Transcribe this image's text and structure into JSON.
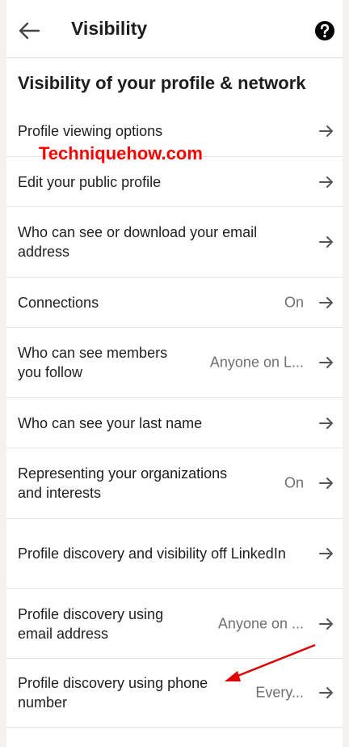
{
  "header": {
    "title": "Visibility",
    "back_icon": "arrow-left-icon",
    "help_icon": "help-circle-icon"
  },
  "section_title": "Visibility of your profile & network",
  "watermark": "Techniquehow.com",
  "rows": [
    {
      "label": "Profile viewing options",
      "value": ""
    },
    {
      "label": "Edit your public profile",
      "value": ""
    },
    {
      "label": "Who can see or download your email address",
      "value": ""
    },
    {
      "label": "Connections",
      "value": "On"
    },
    {
      "label": "Who can see members you follow",
      "value": "Anyone on L..."
    },
    {
      "label": "Who can see your last name",
      "value": ""
    },
    {
      "label": "Representing your organizations and interests",
      "value": "On"
    },
    {
      "label": "Profile discovery and visibility off LinkedIn",
      "value": ""
    },
    {
      "label": "Profile discovery using email address",
      "value": "Anyone on ..."
    },
    {
      "label": "Profile discovery using phone number",
      "value": "Every..."
    }
  ],
  "colors": {
    "accent_annotation": "#e00000",
    "text_primary": "#1d1d1d",
    "text_secondary": "#6f6f6f",
    "divider": "#e3e3e3"
  }
}
